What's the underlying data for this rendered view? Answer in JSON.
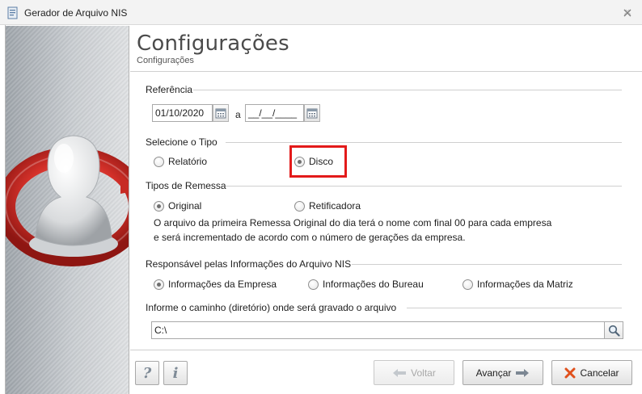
{
  "window": {
    "title": "Gerador de Arquivo NIS",
    "app_icon": "document-app-icon",
    "close_icon": "close-icon"
  },
  "header": {
    "title": "Configurações",
    "subtitle": "Configurações"
  },
  "referencia": {
    "label": "Referência",
    "date_from": "01/10/2020",
    "separator": "a",
    "date_to": "__/__/____",
    "calendar_icon": "calendar-icon"
  },
  "tipo": {
    "label": "Selecione o Tipo",
    "options": [
      {
        "label": "Relatório",
        "selected": false
      },
      {
        "label": "Disco",
        "selected": true
      }
    ]
  },
  "remessa": {
    "label": "Tipos de Remessa",
    "options": [
      {
        "label": "Original",
        "selected": true
      },
      {
        "label": "Retificadora",
        "selected": false
      }
    ],
    "info_line1": "O arquivo da primeira Remessa Original do dia terá o nome com final 00 para cada empresa",
    "info_line2": "e será incrementado de acordo com o número de gerações da empresa."
  },
  "responsavel": {
    "label": "Responsável pelas Informações do Arquivo NIS",
    "options": [
      {
        "label": "Informações da Empresa",
        "selected": true
      },
      {
        "label": "Informações do Bureau",
        "selected": false
      },
      {
        "label": "Informações da Matriz",
        "selected": false
      }
    ]
  },
  "caminho": {
    "label": "Informe o caminho (diretório) onde será gravado o arquivo",
    "value": "C:\\",
    "search_icon": "search-icon"
  },
  "footer": {
    "help_label": "?",
    "info_label": "i",
    "back_label": "Voltar",
    "next_label": "Avançar",
    "cancel_label": "Cancelar"
  },
  "colors": {
    "highlight": "#e31a1a",
    "cancel_icon": "#e0501c",
    "arrow": "#7c8793"
  }
}
